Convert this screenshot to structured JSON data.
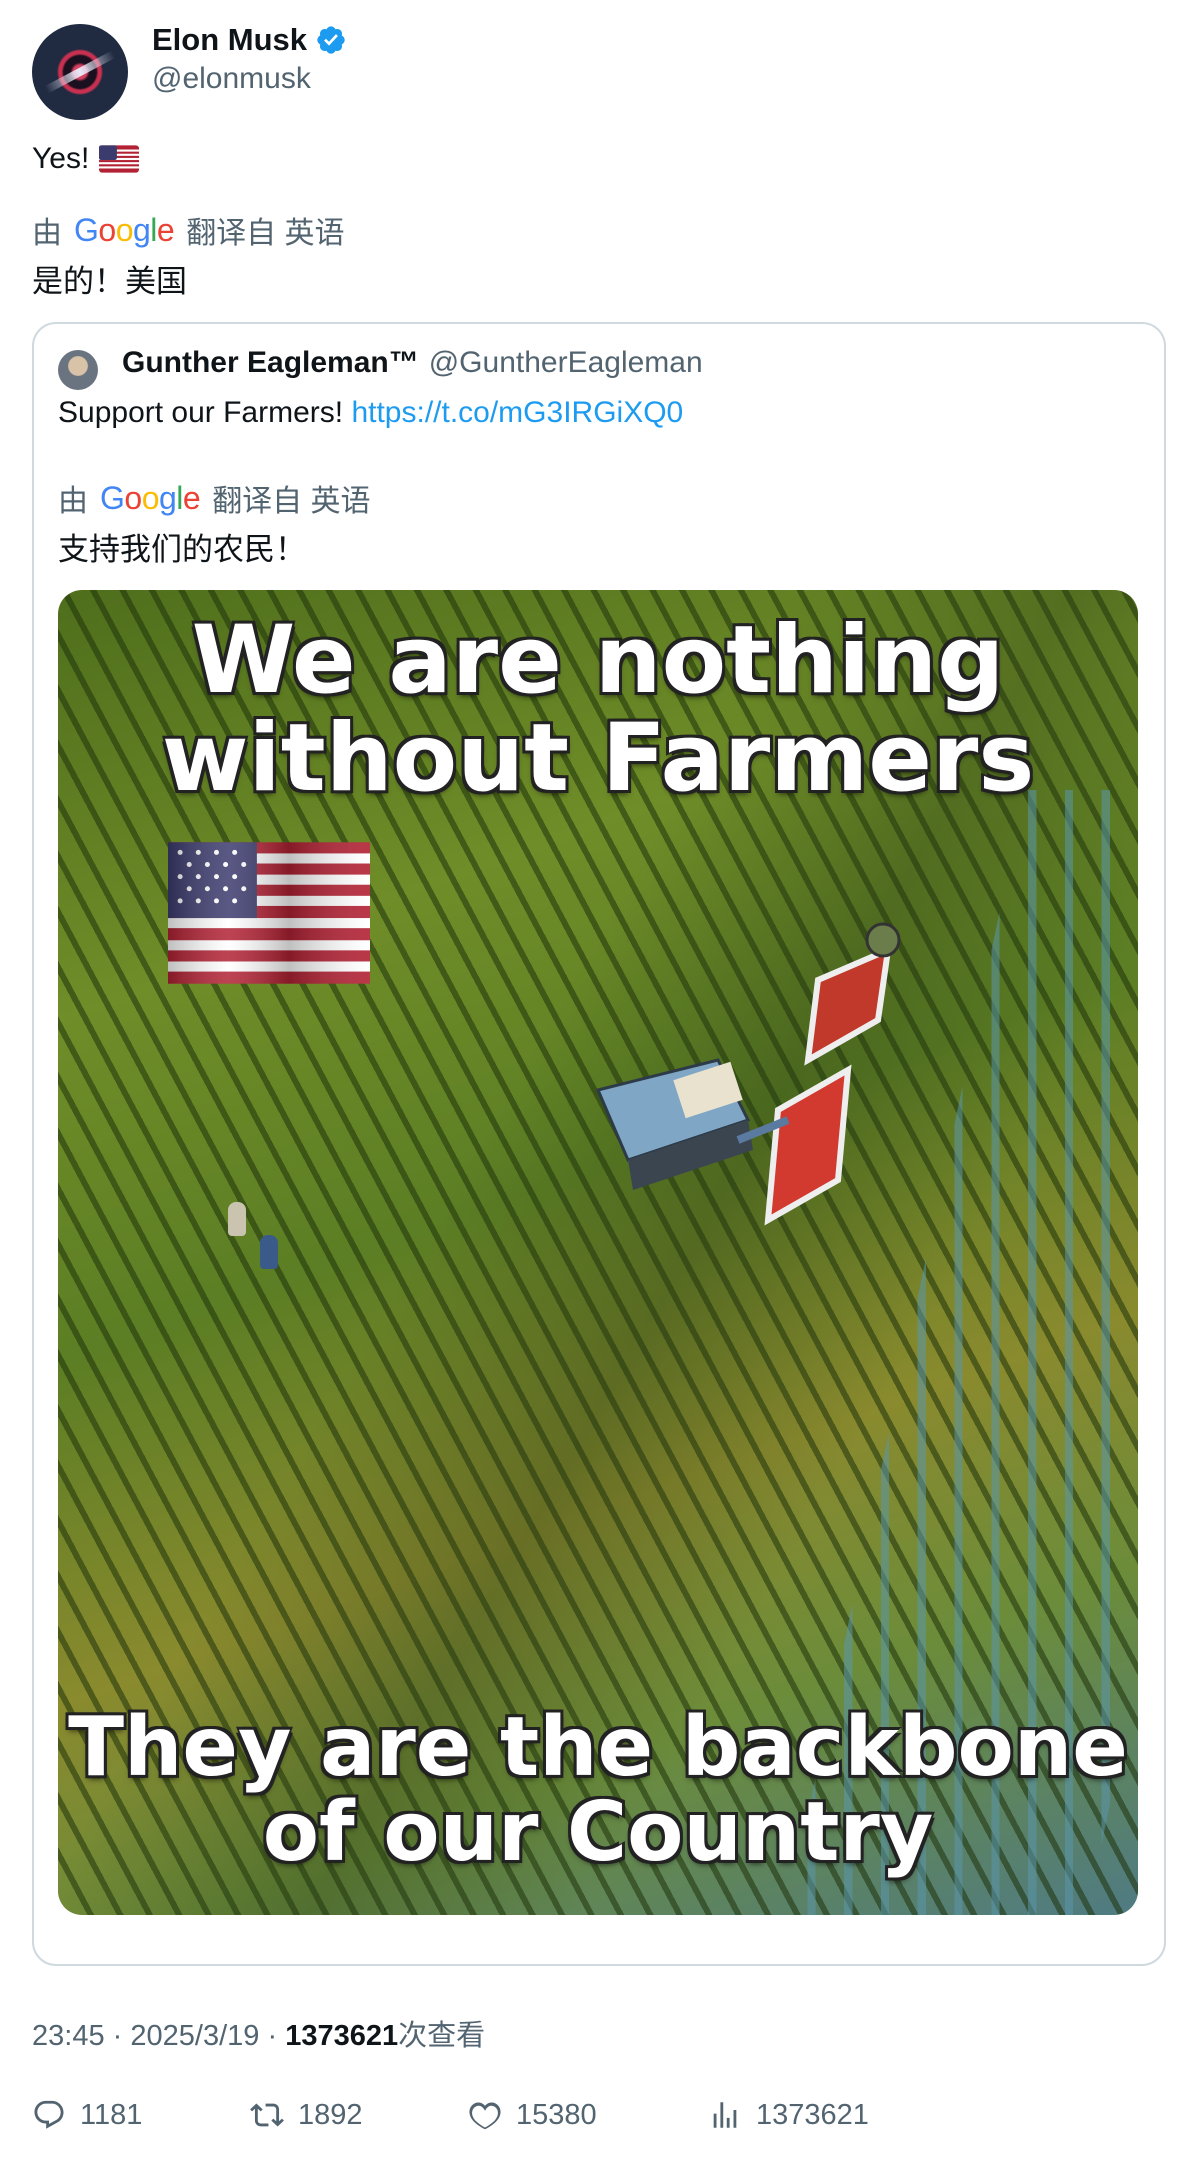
{
  "author": {
    "display_name": "Elon Musk",
    "handle": "@elonmusk",
    "verified_icon": "verified-badge-icon",
    "verified_color": "#1d9bf0"
  },
  "tweet": {
    "text": "Yes!",
    "emoji": "us-flag-emoji",
    "translation": {
      "prefix": "由",
      "provider": "Google",
      "suffix": "翻译自 英语",
      "text": "是的！美国"
    }
  },
  "quote": {
    "display_name": "Gunther Eagleman™",
    "handle": "@GuntherEagleman",
    "text": "Support our Farmers!",
    "link": "https://t.co/mG3IRGiXQ0",
    "translation": {
      "prefix": "由",
      "provider": "Google",
      "suffix": "翻译自 英语",
      "text": "支持我们的农民！"
    },
    "image": {
      "top_line1": "We are nothing",
      "top_line2": "without Farmers",
      "bottom_line1": "They are the backbone",
      "bottom_line2": "of our Country"
    }
  },
  "meta": {
    "time": "23:45",
    "separator": "·",
    "date": "2025/3/19",
    "views": "1373621",
    "views_suffix": "次查看"
  },
  "actions": {
    "replies": "1181",
    "retweets": "1892",
    "likes": "15380",
    "views": "1373621"
  },
  "colors": {
    "text": "#0f1419",
    "secondary": "#536471",
    "link": "#1d9bf0",
    "border": "#cfd9de"
  }
}
